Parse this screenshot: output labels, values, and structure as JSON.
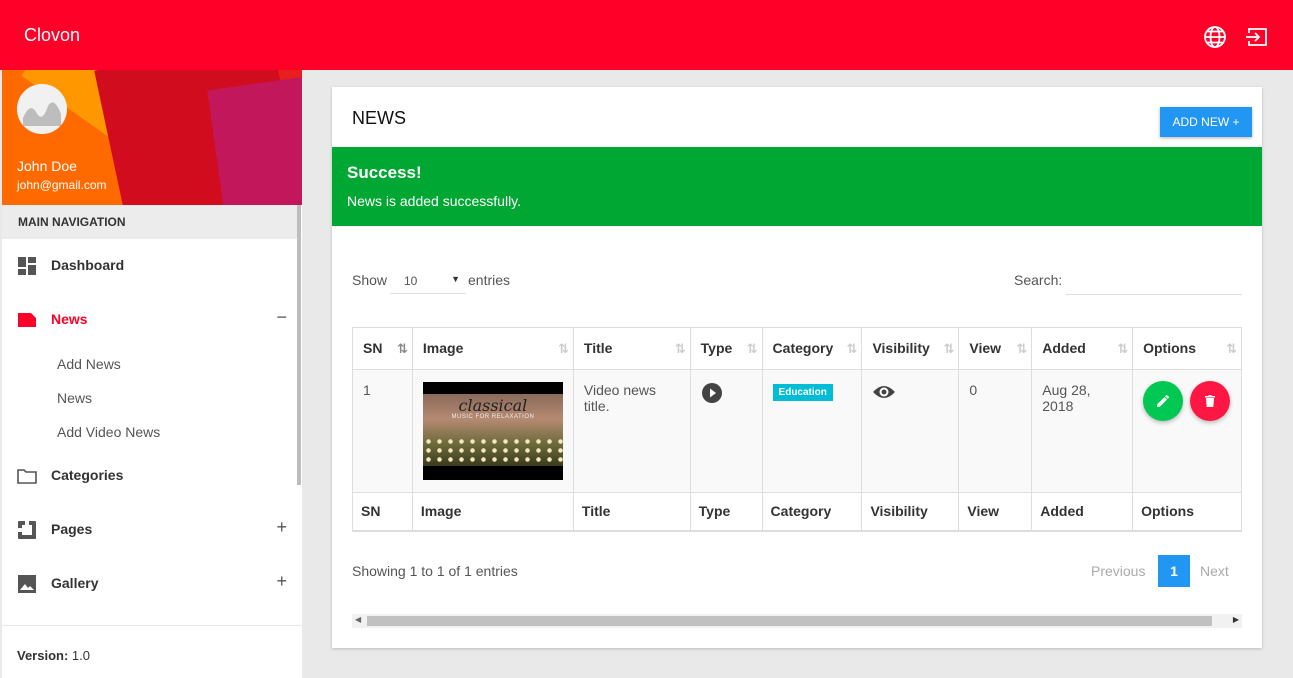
{
  "topbar": {
    "brand": "Clovon",
    "icons": [
      "globe-icon",
      "logout-icon"
    ]
  },
  "user": {
    "name": "John Doe",
    "email": "john@gmail.com"
  },
  "nav": {
    "header": "MAIN NAVIGATION",
    "items": [
      {
        "label": "Dashboard",
        "icon": "dashboard-icon"
      },
      {
        "label": "News",
        "icon": "news-icon",
        "side": "−",
        "active": true
      },
      {
        "label": "Categories",
        "icon": "folder-icon"
      },
      {
        "label": "Pages",
        "icon": "pages-icon",
        "side": "+"
      },
      {
        "label": "Gallery",
        "icon": "image-icon",
        "side": "+"
      }
    ],
    "subitems": [
      "Add News",
      "News",
      "Add Video News"
    ]
  },
  "footer": {
    "version_label": "Version:",
    "version_value": "1.0"
  },
  "card": {
    "title": "NEWS",
    "add_button": "ADD NEW +",
    "alert": {
      "title": "Success!",
      "message": "News is added successfully."
    },
    "show_label": "Show",
    "page_size": "10",
    "entries_label": "entries",
    "search_label": "Search:",
    "search_value": "",
    "columns": [
      "SN",
      "Image",
      "Title",
      "Type",
      "Category",
      "Visibility",
      "View",
      "Added",
      "Options"
    ],
    "rows": [
      {
        "sn": "1",
        "image_title": "classical",
        "image_subtitle": "MUSIC FOR RELAXATION",
        "title": "Video news title.",
        "type_icon": "play-circle-icon",
        "category": "Education",
        "visibility_icon": "eye-icon",
        "view": "0",
        "added": "Aug 28, 2018",
        "edit_color": "#00c853",
        "delete_color": "#ff1744"
      }
    ],
    "showing": "Showing 1 to 1 of 1 entries",
    "pagination": {
      "previous": "Previous",
      "current": "1",
      "next": "Next"
    }
  },
  "colors": {
    "primary": "#ff0028",
    "accent": "#2196f3",
    "success": "#00a833",
    "badge": "#00bcd4"
  }
}
